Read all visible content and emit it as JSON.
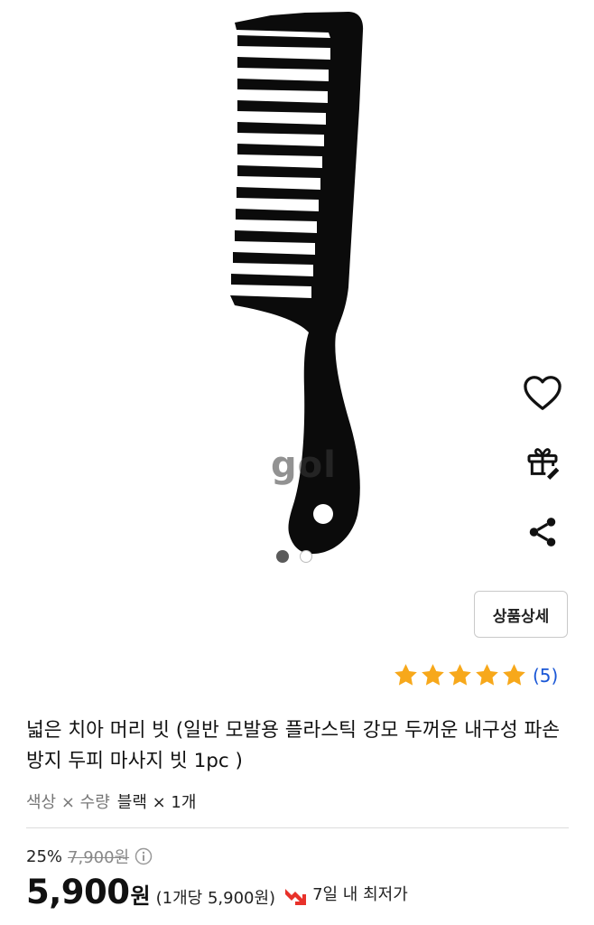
{
  "gallery": {
    "watermark": "gol",
    "total_images": 2,
    "active_index": 1
  },
  "side_actions": [
    {
      "name": "wishlist",
      "icon": "heart-outline-icon"
    },
    {
      "name": "gift",
      "icon": "gift-icon"
    },
    {
      "name": "share",
      "icon": "share-icon"
    }
  ],
  "detail_button": {
    "label": "상품상세"
  },
  "rating": {
    "stars": 5,
    "max_stars": 5,
    "review_count": "(5)",
    "star_color": "#f7a81b"
  },
  "product": {
    "title": "넓은 치아 머리 빗 (일반 모발용 플라스틱 강모 두꺼운 내구성 파손 방지 두피 마사지 빗 1pc )"
  },
  "option": {
    "label": "색상 × 수량",
    "value": "블랙 × 1개"
  },
  "pricing": {
    "discount_rate": "25%",
    "original_price": "7,900원",
    "price_number": "5,900",
    "price_unit": "원",
    "unit_price": "(1개당 5,900원)",
    "lowest_label": "7일 내 최저가",
    "accent_color": "#e8312a"
  }
}
